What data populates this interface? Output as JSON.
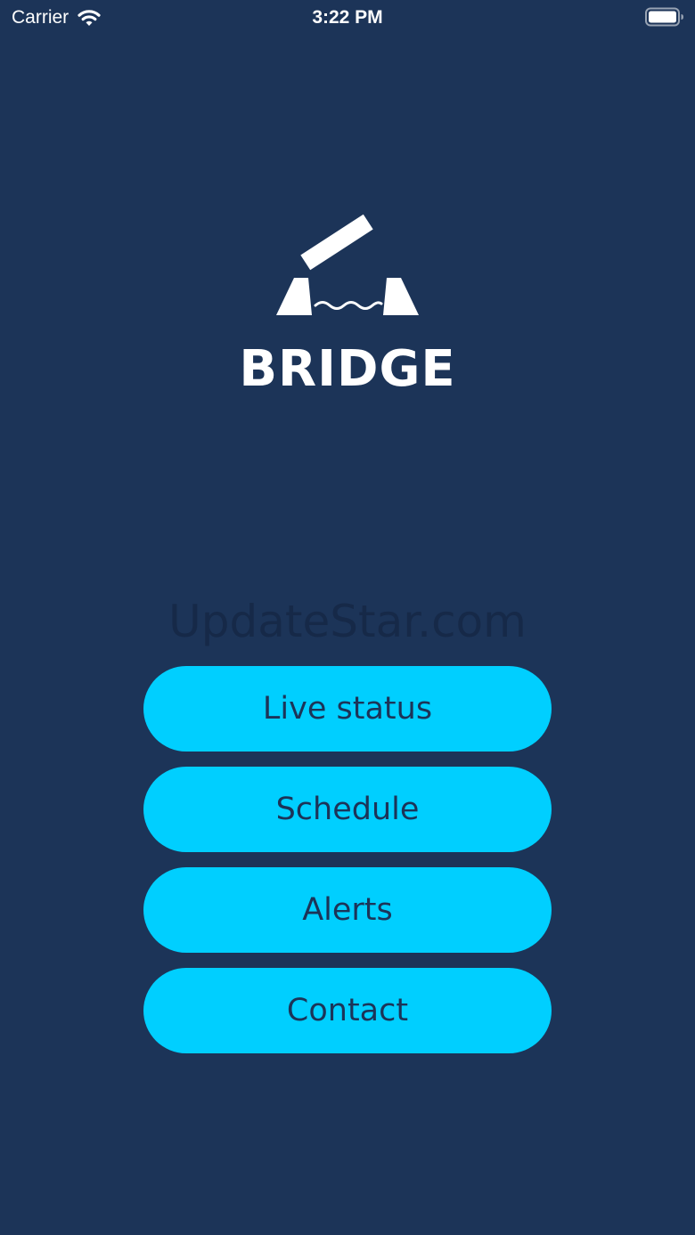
{
  "status_bar": {
    "carrier": "Carrier",
    "time": "3:22 PM",
    "wifi_icon": "wifi-icon",
    "battery_icon": "battery-icon"
  },
  "app": {
    "logo_icon": "drawbridge-icon",
    "title": "BRIDGE"
  },
  "watermark": "UpdateStar.com",
  "menu": {
    "live_status": "Live status",
    "schedule": "Schedule",
    "alerts": "Alerts",
    "contact": "Contact"
  },
  "colors": {
    "background": "#1c3458",
    "button": "#00cfff",
    "button_text": "#1c3458",
    "foreground": "#ffffff"
  }
}
